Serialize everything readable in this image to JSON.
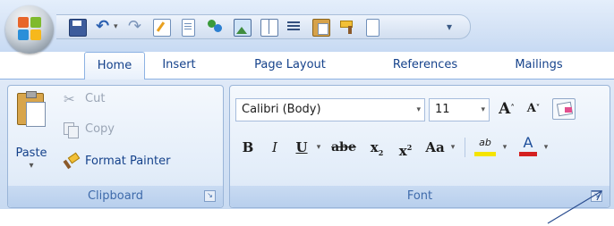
{
  "window": {
    "qat_icons": [
      "save-icon",
      "undo-icon",
      "redo-icon",
      "edit-icon",
      "document-icon",
      "people-icon",
      "picture-icon",
      "book-icon",
      "list-icon",
      "paste-icon",
      "format-painter-icon",
      "new-document-icon"
    ],
    "qat_overflow": "▾"
  },
  "tabs": [
    {
      "label": "Home",
      "active": true
    },
    {
      "label": "Insert",
      "active": false
    },
    {
      "label": "Page Layout",
      "active": false
    },
    {
      "label": "References",
      "active": false
    },
    {
      "label": "Mailings",
      "active": false
    }
  ],
  "clipboard": {
    "paste_label": "Paste",
    "paste_arrow": "▾",
    "cut_label": "Cut",
    "copy_label": "Copy",
    "format_painter_label": "Format Painter",
    "group_label": "Clipboard",
    "launcher": "↘"
  },
  "font": {
    "font_name": "Calibri (Body)",
    "font_size": "11",
    "grow_font": "A",
    "shrink_font": "A",
    "bold": "B",
    "italic": "I",
    "underline": "U",
    "strikethrough": "abe",
    "subscript": "x",
    "subscript_mark": "2",
    "superscript": "x",
    "superscript_mark": "2",
    "change_case": "Aa",
    "highlight": "ab",
    "font_color": "A",
    "group_label": "Font",
    "launcher": "↘"
  },
  "colors": {
    "accent": "#15428b",
    "highlight_yellow": "#f5e400",
    "font_color_red": "#d42020"
  }
}
